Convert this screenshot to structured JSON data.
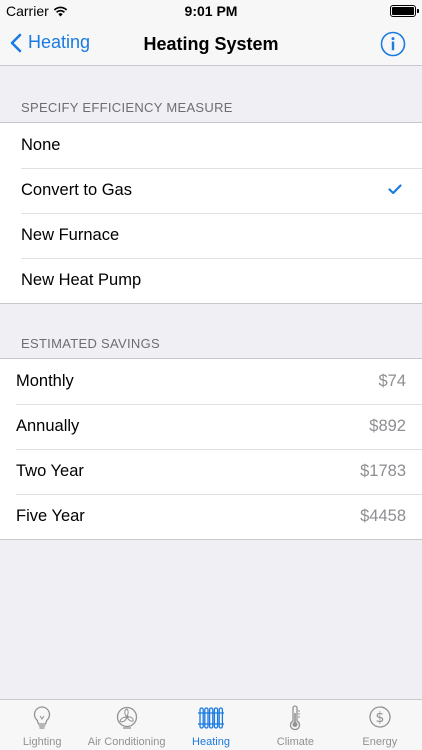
{
  "status_bar": {
    "carrier": "Carrier",
    "time": "9:01 PM"
  },
  "nav": {
    "back_label": "Heating",
    "title": "Heating System",
    "info_icon": "info-circle-icon"
  },
  "efficiency": {
    "header": "SPECIFY EFFICIENCY MEASURE",
    "options": [
      {
        "label": "None",
        "selected": false
      },
      {
        "label": "Convert to Gas",
        "selected": true
      },
      {
        "label": "New Furnace",
        "selected": false
      },
      {
        "label": "New Heat Pump",
        "selected": false
      }
    ]
  },
  "savings": {
    "header": "ESTIMATED SAVINGS",
    "rows": [
      {
        "label": "Monthly",
        "value": "$74"
      },
      {
        "label": "Annually",
        "value": "$892"
      },
      {
        "label": "Two Year",
        "value": "$1783"
      },
      {
        "label": "Five Year",
        "value": "$4458"
      }
    ]
  },
  "tabs": [
    {
      "label": "Lighting",
      "icon": "lightbulb-icon",
      "active": false
    },
    {
      "label": "Air Conditioning",
      "icon": "fan-icon",
      "active": false
    },
    {
      "label": "Heating",
      "icon": "radiator-icon",
      "active": true
    },
    {
      "label": "Climate",
      "icon": "thermometer-icon",
      "active": false
    },
    {
      "label": "Energy",
      "icon": "dollar-icon",
      "active": false
    }
  ],
  "colors": {
    "accent": "#1a7be0",
    "inactive": "#929292",
    "background": "#efeff4"
  }
}
